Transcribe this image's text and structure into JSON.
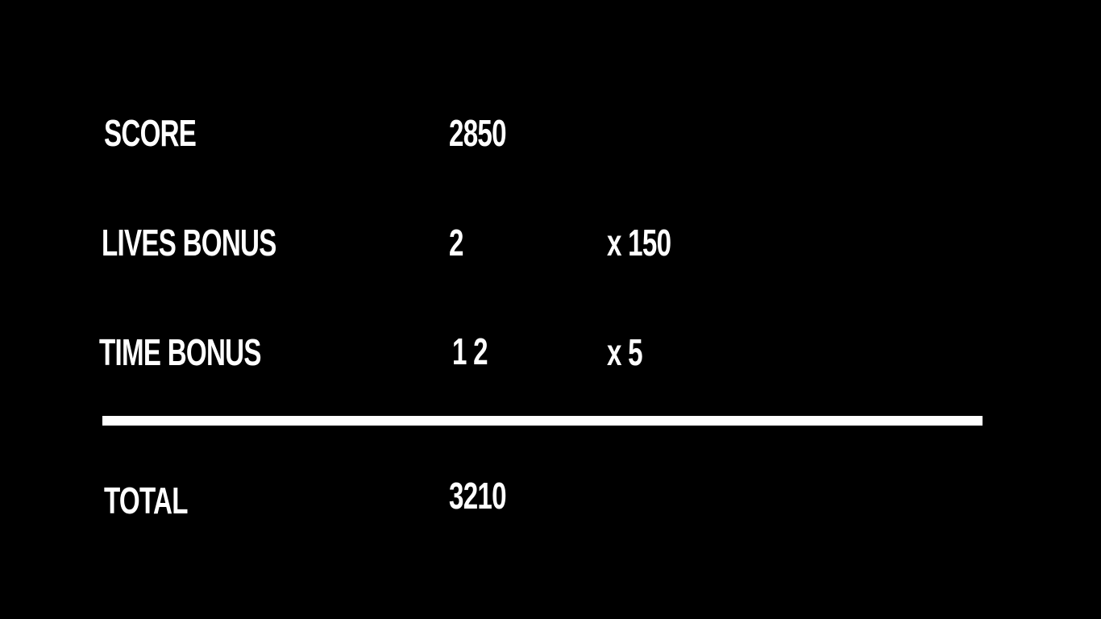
{
  "colors": {
    "background": "#000000",
    "text": "#ffffff",
    "divider": "#ffffff"
  },
  "results": {
    "score": {
      "label": "SCORE",
      "value": "2850"
    },
    "lives_bonus": {
      "label": "LIVES BONUS",
      "count": "2",
      "multiplier": "x 150"
    },
    "time_bonus": {
      "label": "TIME BONUS",
      "count": "1 2",
      "multiplier": "x 5"
    },
    "total": {
      "label": "TOTAL",
      "value": "3210"
    }
  }
}
